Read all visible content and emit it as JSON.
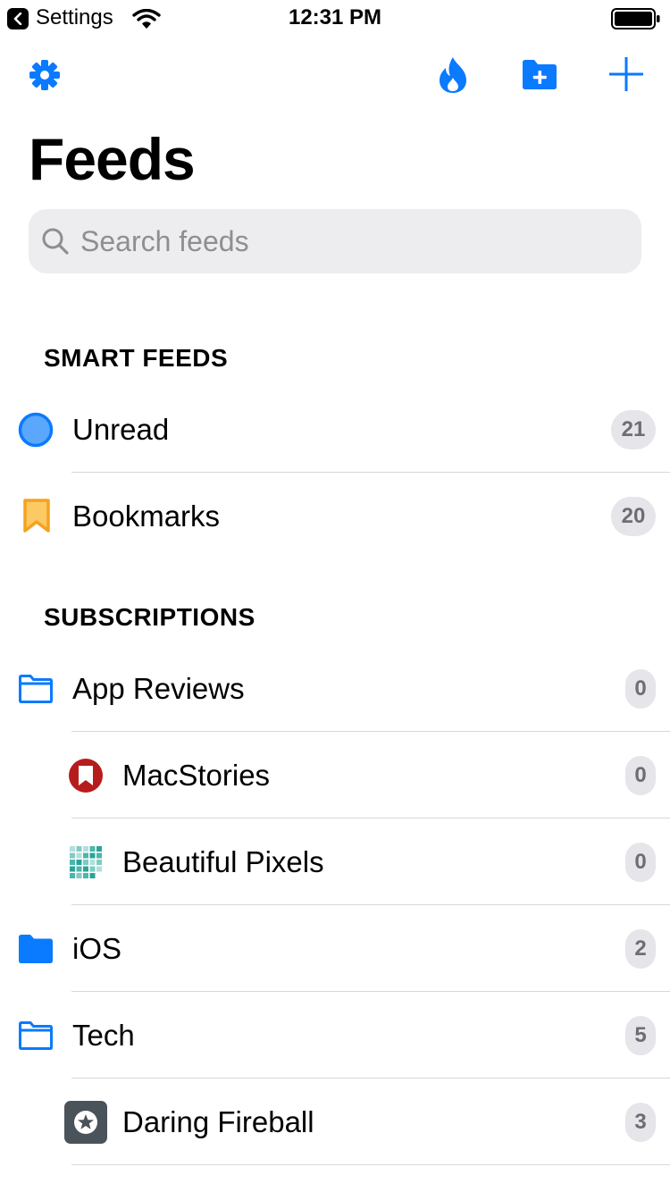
{
  "status_bar": {
    "back_app": "Settings",
    "time": "12:31 PM"
  },
  "toolbar": {
    "icons": [
      "gear-icon",
      "flame-icon",
      "folder-plus-icon",
      "plus-icon"
    ],
    "accent_color": "#0a7aff"
  },
  "page": {
    "title": "Feeds"
  },
  "search": {
    "placeholder": "Search feeds",
    "value": ""
  },
  "smart_feeds": {
    "header": "SMART FEEDS",
    "items": [
      {
        "label": "Unread",
        "count": "21",
        "icon": "unread-circle-icon"
      },
      {
        "label": "Bookmarks",
        "count": "20",
        "icon": "bookmark-icon"
      }
    ]
  },
  "subscriptions": {
    "header": "SUBSCRIPTIONS",
    "items": [
      {
        "label": "App Reviews",
        "count": "0",
        "icon": "folder-outline-icon",
        "type": "folder"
      },
      {
        "label": "MacStories",
        "count": "0",
        "icon": "macstories-icon",
        "type": "feed"
      },
      {
        "label": "Beautiful Pixels",
        "count": "0",
        "icon": "beautiful-pixels-icon",
        "type": "feed"
      },
      {
        "label": "iOS",
        "count": "2",
        "icon": "folder-filled-icon",
        "type": "folder"
      },
      {
        "label": "Tech",
        "count": "5",
        "icon": "folder-outline-icon",
        "type": "folder"
      },
      {
        "label": "Daring Fireball",
        "count": "3",
        "icon": "daring-fireball-icon",
        "type": "feed"
      }
    ]
  }
}
